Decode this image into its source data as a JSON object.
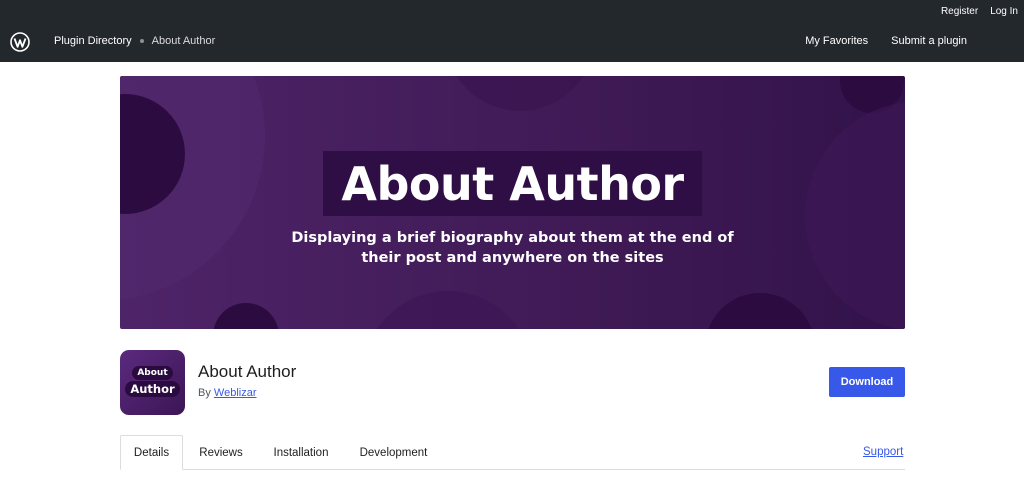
{
  "header": {
    "breadcrumb_home": "Plugin Directory",
    "breadcrumb_current": "About Author",
    "register": "Register",
    "login": "Log In",
    "my_favorites": "My Favorites",
    "submit_plugin": "Submit a plugin",
    "logo_icon": "wordpress-logo-icon"
  },
  "banner": {
    "title": "About Author",
    "subtitle": "Displaying a brief biography about them at the end of their post and anywhere on the sites"
  },
  "plugin": {
    "icon_line1": "About",
    "icon_line2": "Author",
    "name": "About Author",
    "by_prefix": "By",
    "author": "Weblizar",
    "download_label": "Download"
  },
  "tabs": [
    {
      "label": "Details"
    },
    {
      "label": "Reviews"
    },
    {
      "label": "Installation"
    },
    {
      "label": "Development"
    }
  ],
  "support_label": "Support",
  "colors": {
    "topbar": "#23282d",
    "accent": "#3858e9",
    "banner_purple": "#4e2468"
  }
}
